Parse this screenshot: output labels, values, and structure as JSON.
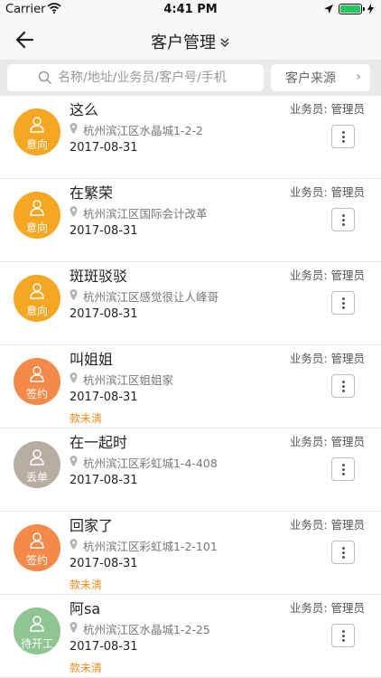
{
  "status_bar": {
    "carrier": "Carrier",
    "time": "4:41 PM"
  },
  "nav": {
    "title": "客户管理"
  },
  "search": {
    "placeholder": "名称/地址/业务员/客户号/手机"
  },
  "filter": {
    "source_label": "客户来源"
  },
  "colors": {
    "intent": "#f5a623",
    "signed": "#f5894a",
    "lost": "#b7ada1",
    "pending": "#8fc493",
    "note": "#f28a1c"
  },
  "customers": [
    {
      "name": "这么",
      "status": "意向",
      "status_color": "#f5a623",
      "address": "杭州滨江区水晶城1-2-2",
      "date": "2017-08-31",
      "salesperson": "业务员: 管理员",
      "note": ""
    },
    {
      "name": "在繁荣",
      "status": "意向",
      "status_color": "#f5a623",
      "address": "杭州滨江区国际会计改革",
      "date": "2017-08-31",
      "salesperson": "业务员: 管理员",
      "note": ""
    },
    {
      "name": "斑斑驳驳",
      "status": "意向",
      "status_color": "#f5a623",
      "address": "杭州滨江区感觉很让人峰哥",
      "date": "2017-08-31",
      "salesperson": "业务员: 管理员",
      "note": ""
    },
    {
      "name": "叫姐姐",
      "status": "签约",
      "status_color": "#f5894a",
      "address": "杭州滨江区姐姐家",
      "date": "2017-08-31",
      "salesperson": "业务员: 管理员",
      "note": "款未清"
    },
    {
      "name": "在一起时",
      "status": "丢单",
      "status_color": "#b7ada1",
      "address": "杭州滨江区彩虹城1-4-408",
      "date": "2017-08-31",
      "salesperson": "业务员: 管理员",
      "note": ""
    },
    {
      "name": "回家了",
      "status": "签约",
      "status_color": "#f5894a",
      "address": "杭州滨江区彩虹城1-2-101",
      "date": "2017-08-31",
      "salesperson": "业务员: 管理员",
      "note": "款未清"
    },
    {
      "name": "阿sa",
      "status": "待开工",
      "status_color": "#8fc493",
      "address": "杭州滨江区水晶城1-2-25",
      "date": "2017-08-31",
      "salesperson": "业务员: 管理员",
      "note": "款未清"
    }
  ]
}
